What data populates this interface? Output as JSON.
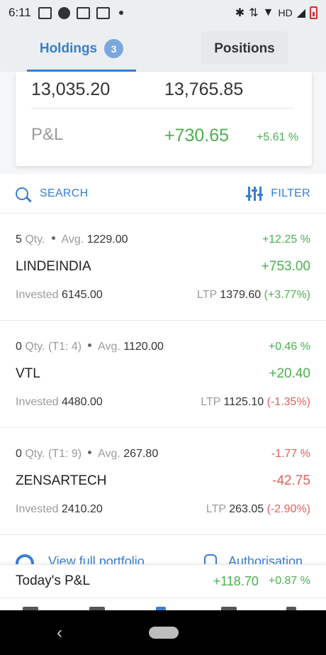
{
  "status_bar": {
    "time": "6:11",
    "network": "HD"
  },
  "tabs": {
    "holdings": {
      "label": "Holdings",
      "badge": "3"
    },
    "positions": {
      "label": "Positions"
    }
  },
  "summary": {
    "invested": "13,035.20",
    "current": "13,765.85",
    "pnl_label": "P&L",
    "pnl_value": "+730.65",
    "pnl_percent": "+5.61 %"
  },
  "toolbar": {
    "search_label": "SEARCH",
    "filter_label": "FILTER"
  },
  "holdings": [
    {
      "qty": "5",
      "qty_label": "Qty.",
      "t1": "",
      "avg_label": "Avg.",
      "avg": "1229.00",
      "change_percent": "+12.25 %",
      "symbol": "LINDEINDIA",
      "pnl": "+753.00",
      "invested_label": "Invested",
      "invested": "6145.00",
      "ltp_label": "LTP",
      "ltp": "1379.60",
      "ltp_change": "(+3.77%)"
    },
    {
      "qty": "0",
      "qty_label": "Qty.",
      "t1": "(T1: 4)",
      "avg_label": "Avg.",
      "avg": "1120.00",
      "change_percent": "+0.46 %",
      "symbol": "VTL",
      "pnl": "+20.40",
      "invested_label": "Invested",
      "invested": "4480.00",
      "ltp_label": "LTP",
      "ltp": "1125.10",
      "ltp_change": "(-1.35%)"
    },
    {
      "qty": "0",
      "qty_label": "Qty.",
      "t1": "(T1: 9)",
      "avg_label": "Avg.",
      "avg": "267.80",
      "change_percent": "-1.77 %",
      "symbol": "ZENSARTECH",
      "pnl": "-42.75",
      "invested_label": "Invested",
      "invested": "2410.20",
      "ltp_label": "LTP",
      "ltp": "263.05",
      "ltp_change": "(-2.90%)"
    }
  ],
  "links": {
    "view_portfolio": "View full portfolio",
    "authorisation": "Authorisation"
  },
  "today": {
    "label": "Today's P&L",
    "value": "+118.70",
    "percent": "+0.87 %"
  },
  "colors": {
    "accent": "#387ed1",
    "profit": "#4caf50",
    "loss": "#e25f5b"
  }
}
